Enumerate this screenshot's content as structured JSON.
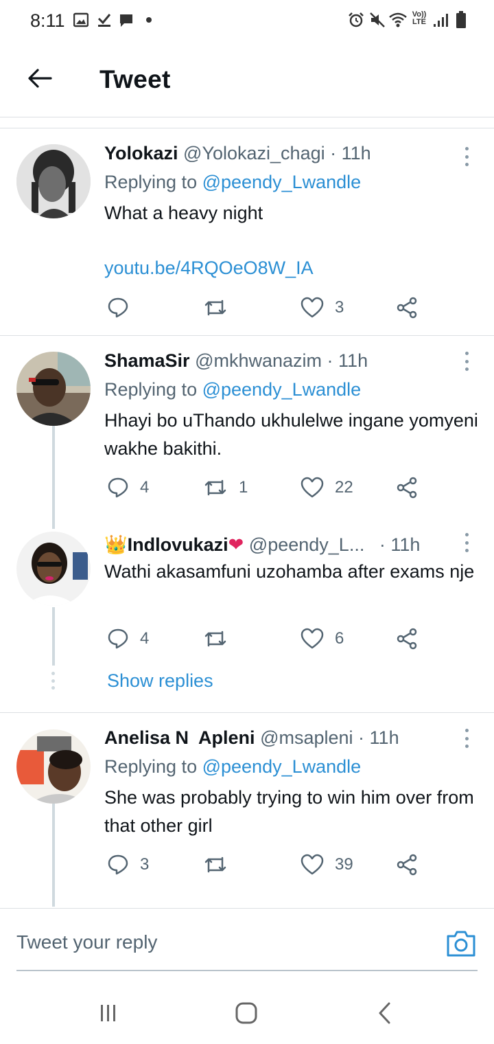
{
  "status_bar": {
    "time": "8:11",
    "network_label": "Vo)) LTE",
    "icons": [
      "image-icon",
      "check-icon",
      "chat-bubble-icon",
      "dot-icon",
      "alarm-icon",
      "mute-icon",
      "wifi-icon",
      "signal-icon",
      "battery-icon"
    ]
  },
  "header": {
    "title": "Tweet",
    "back_icon": "arrow-left-icon"
  },
  "tweets": [
    {
      "name": "Yolokazi",
      "handle": "@Yolokazi_chagi",
      "time": "· 11h",
      "replying_prefix": "Replying to ",
      "replying_to": "@peendy_Lwandle",
      "text": "What a heavy night",
      "link": "youtu.be/4RQOeO8W_IA",
      "reply_count": "",
      "retweet_count": "",
      "like_count": "3"
    },
    {
      "name": "ShamaSir",
      "handle": "@mkhwanazim",
      "time": "· 11h",
      "replying_prefix": "Replying to ",
      "replying_to": "@peendy_Lwandle",
      "text": "Hhayi bo uThando ukhulelwe ingane yomyeni wakhe bakithi.",
      "reply_count": "4",
      "retweet_count": "1",
      "like_count": "22"
    },
    {
      "name": "Indlovukazi",
      "name_prefix_emoji": "👑",
      "name_suffix_emoji": "❤",
      "handle": "@peendy_L...",
      "time": "· 11h",
      "text": "Wathi akasamfuni uzohamba after exams nje",
      "reply_count": "4",
      "retweet_count": "",
      "like_count": "6",
      "show_replies": "Show replies"
    },
    {
      "name": "Anelisa N  Apleni",
      "handle": "@msapleni",
      "time": "· 11h",
      "replying_prefix": "Replying to ",
      "replying_to": "@peendy_Lwandle",
      "text": "She was probably trying to win him over from that other girl",
      "reply_count": "3",
      "retweet_count": "",
      "like_count": "39"
    }
  ],
  "reply_bar": {
    "placeholder": "Tweet your reply",
    "camera_icon": "camera-icon"
  },
  "nav_bar": {
    "icons": [
      "recent-apps-icon",
      "home-icon",
      "back-icon"
    ]
  },
  "colors": {
    "link": "#2b8fd4",
    "text": "#0f1419",
    "secondary": "#536471",
    "divider": "#dcdfe3",
    "like_heart": "#e0245e"
  }
}
